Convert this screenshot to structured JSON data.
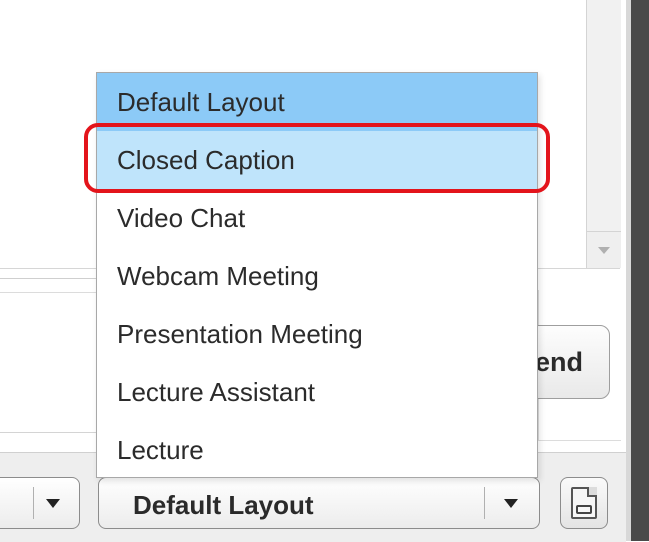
{
  "dropdown": {
    "items": [
      {
        "label": "Default Layout",
        "state": "selected"
      },
      {
        "label": "Closed Caption",
        "state": "hover"
      },
      {
        "label": "Video Chat",
        "state": "normal"
      },
      {
        "label": "Webcam Meeting",
        "state": "normal"
      },
      {
        "label": "Presentation Meeting",
        "state": "normal"
      },
      {
        "label": "Lecture Assistant",
        "state": "normal"
      },
      {
        "label": "Lecture",
        "state": "normal"
      }
    ]
  },
  "send_button": {
    "label": "Send"
  },
  "layout_select": {
    "value": "Default Layout"
  },
  "icons": {
    "closed_caption": "closed-caption-document-icon",
    "dropdown_arrow": "triangle-down"
  },
  "colors": {
    "selected_bg": "#8ccaf7",
    "hover_bg": "#bfe4fb",
    "highlight_border": "#e3141b"
  }
}
